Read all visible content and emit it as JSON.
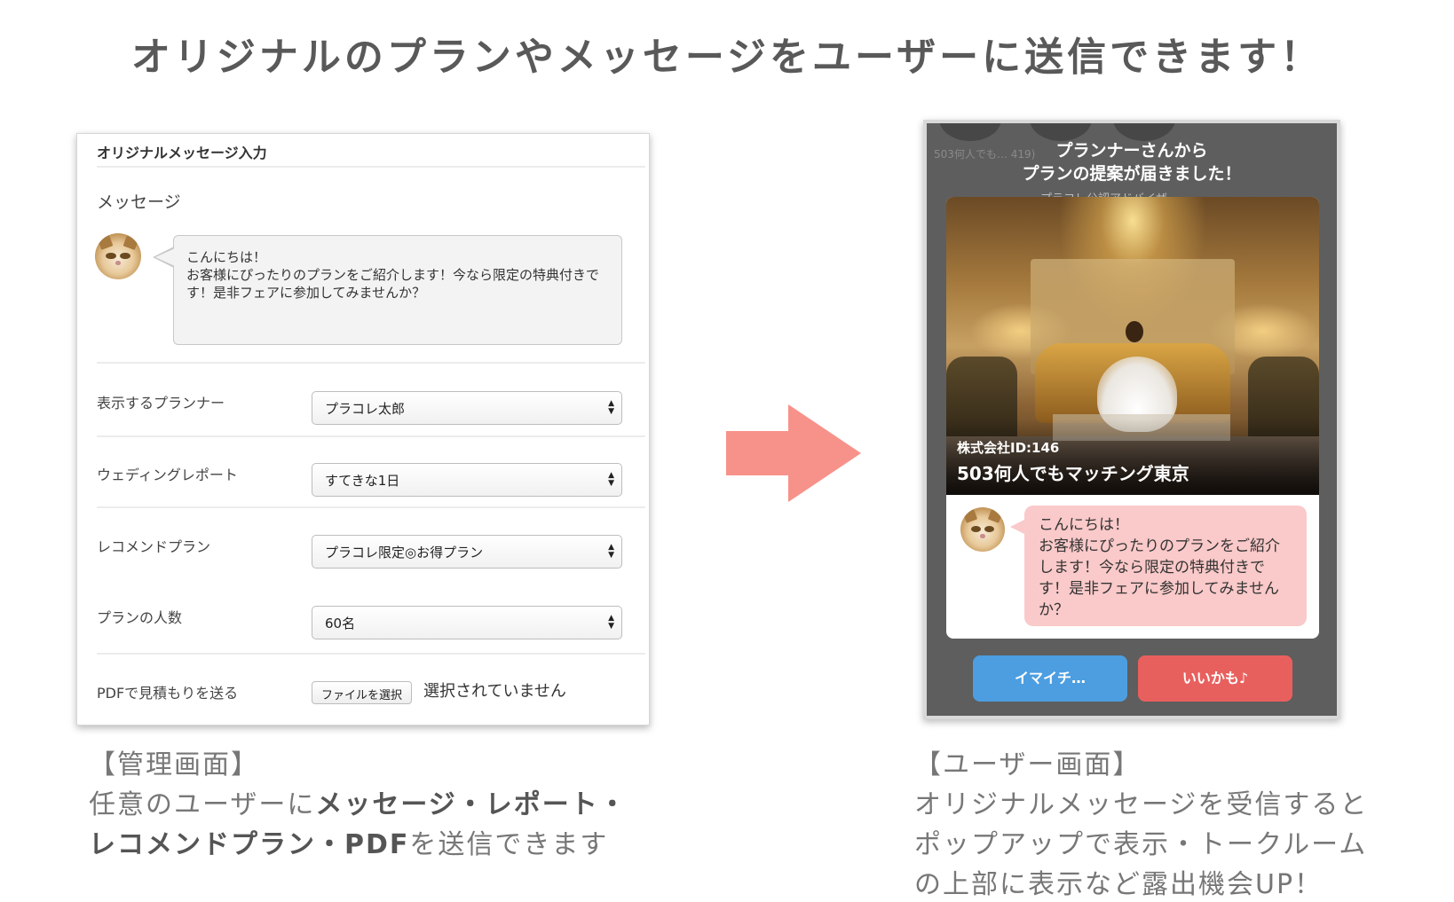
{
  "headline": "オリジナルのプランやメッセージをユーザーに送信できます！",
  "admin": {
    "title": "オリジナルメッセージ入力",
    "message_label": "メッセージ",
    "message_text": "こんにちは！\nお客様にぴったりのプランをご紹介します！今なら限定の特典付きです！是非フェアに参加してみませんか？",
    "rows": [
      {
        "label": "表示するプランナー",
        "value": "プラコレ太郎"
      },
      {
        "label": "ウェディングレポート",
        "value": "すてきな1日"
      },
      {
        "label": "レコメンドプラン",
        "value": "プラコレ限定◎お得プラン"
      },
      {
        "label": "プランの人数",
        "value": "60名"
      }
    ],
    "pdf_label": "PDFで見積もりを送る",
    "file_button": "ファイルを選択",
    "file_status": "選択されていません"
  },
  "phone": {
    "bg_text": "503何人でも…  419)",
    "bg_text2": "プラコレ公認アドバイザー",
    "popup_title": "プランナーさんから\nプランの提案が届きました！",
    "company_id": "株式会社ID:146",
    "venue_name": "503何人でもマッチング東京",
    "message_text": "こんにちは！\nお客様にぴったりのプランをご紹介します！今なら限定の特典付きです！是非フェアに参加してみませんか？",
    "btn_nah": "イマイチ…",
    "btn_like": "いいかも♪"
  },
  "captions": {
    "left_heading": "【管理画面】",
    "left_line1_plain": "任意のユーザーに",
    "left_line1_bold": "メッセージ・レポート・",
    "left_line2_bold": "レコメンドプラン・PDF",
    "left_line2_plain": "を送信できます",
    "right_heading": "【ユーザー画面】",
    "right_line1": "オリジナルメッセージを受信すると",
    "right_line2": "ポップアップで表示・トークルーム",
    "right_line3": "の上部に表示など露出機会UP！"
  },
  "colors": {
    "arrow": "#f7928a",
    "btn_nah": "#4c9ee0",
    "btn_like": "#e8605e",
    "bubble_user": "#fac9c9"
  }
}
